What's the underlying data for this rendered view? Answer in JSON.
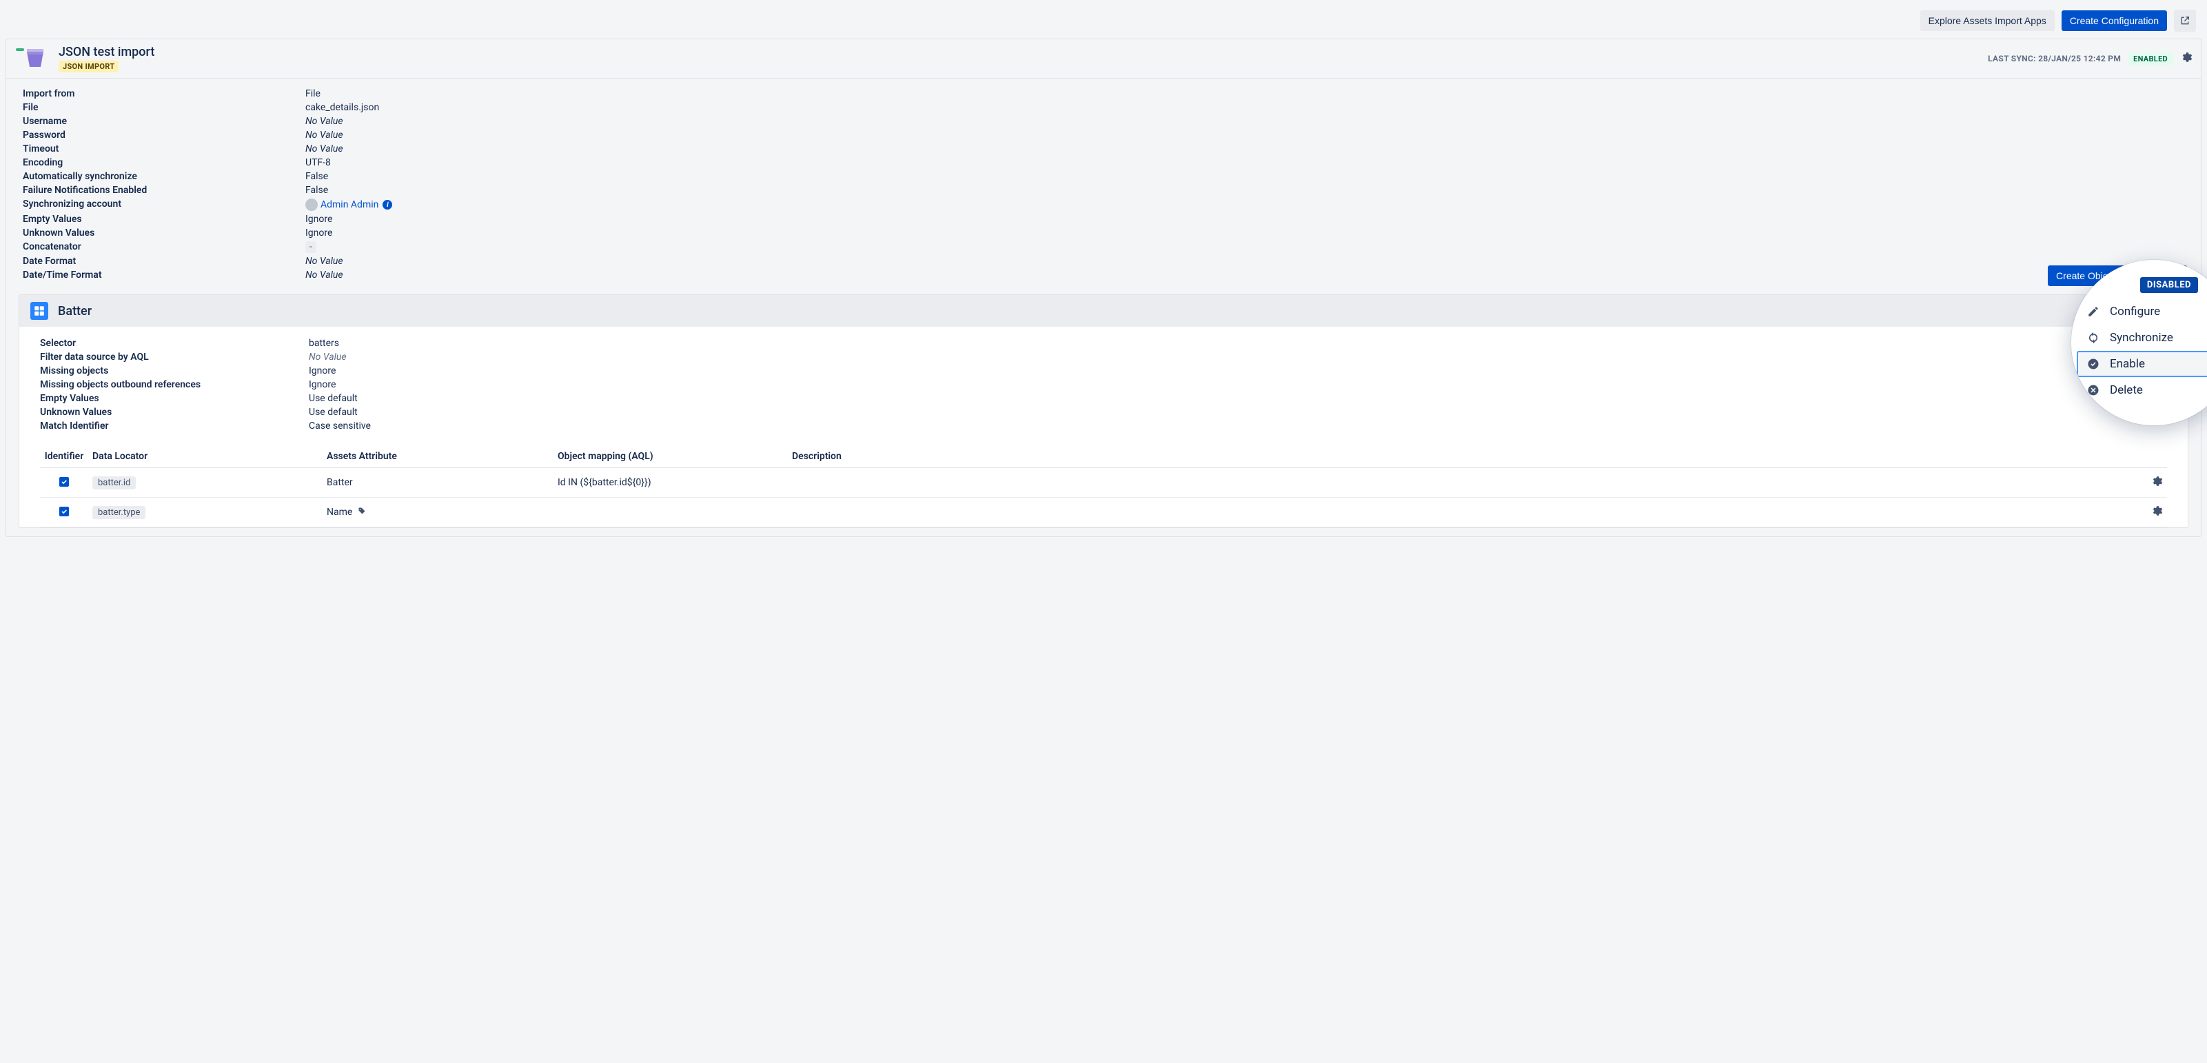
{
  "topbar": {
    "explore": "Explore Assets Import Apps",
    "create_config": "Create Configuration"
  },
  "config_header": {
    "title": "JSON test import",
    "badge": "JSON IMPORT",
    "last_sync_label": "LAST SYNC: 28/JAN/25 12:42 PM",
    "status": "ENABLED"
  },
  "details": {
    "rows": [
      {
        "label": "Import from",
        "value": "File",
        "no_value": false
      },
      {
        "label": "File",
        "value": "cake_details.json",
        "no_value": false
      },
      {
        "label": "Username",
        "value": "No Value",
        "no_value": true
      },
      {
        "label": "Password",
        "value": "No Value",
        "no_value": true
      },
      {
        "label": "Timeout",
        "value": "No Value",
        "no_value": true
      },
      {
        "label": "Encoding",
        "value": "UTF-8",
        "no_value": false
      },
      {
        "label": "Automatically synchronize",
        "value": "False",
        "no_value": false
      },
      {
        "label": "Failure Notifications Enabled",
        "value": "False",
        "no_value": false
      }
    ],
    "sync_account": {
      "label": "Synchronizing account",
      "user": "Admin Admin"
    },
    "rows2": [
      {
        "label": "Empty Values",
        "value": "Ignore",
        "no_value": false
      },
      {
        "label": "Unknown Values",
        "value": "Ignore",
        "no_value": false
      }
    ],
    "concatenator": {
      "label": "Concatenator",
      "value": "-"
    },
    "rows3": [
      {
        "label": "Date Format",
        "value": "No Value",
        "no_value": true
      },
      {
        "label": "Date/Time Format",
        "value": "No Value",
        "no_value": true
      }
    ],
    "create_mapping": "Create Object Type Mapping"
  },
  "object_type": {
    "title": "Batter",
    "rows": [
      {
        "label": "Selector",
        "value": "batters",
        "no_value": false
      },
      {
        "label": "Filter data source by AQL",
        "value": "No Value",
        "no_value": true
      },
      {
        "label": "Missing objects",
        "value": "Ignore",
        "no_value": false
      },
      {
        "label": "Missing objects outbound references",
        "value": "Ignore",
        "no_value": false
      },
      {
        "label": "Empty Values",
        "value": "Use default",
        "no_value": false
      },
      {
        "label": "Unknown Values",
        "value": "Use default",
        "no_value": false
      },
      {
        "label": "Match Identifier",
        "value": "Case sensitive",
        "no_value": false
      }
    ],
    "columns": {
      "identifier": "Identifier",
      "data_locator": "Data Locator",
      "assets_attribute": "Assets Attribute",
      "object_mapping": "Object mapping (AQL)",
      "description": "Description"
    },
    "attrs": [
      {
        "locator": "batter.id",
        "attribute": "Batter",
        "mapping": "Id IN (${batter.id${0}})",
        "has_tag": false
      },
      {
        "locator": "batter.type",
        "attribute": "Name",
        "mapping": "",
        "has_tag": true
      }
    ]
  },
  "lens": {
    "disabled": "DISABLED",
    "menu": {
      "configure": "Configure",
      "synchronize": "Synchronize",
      "enable": "Enable",
      "delete": "Delete"
    }
  }
}
